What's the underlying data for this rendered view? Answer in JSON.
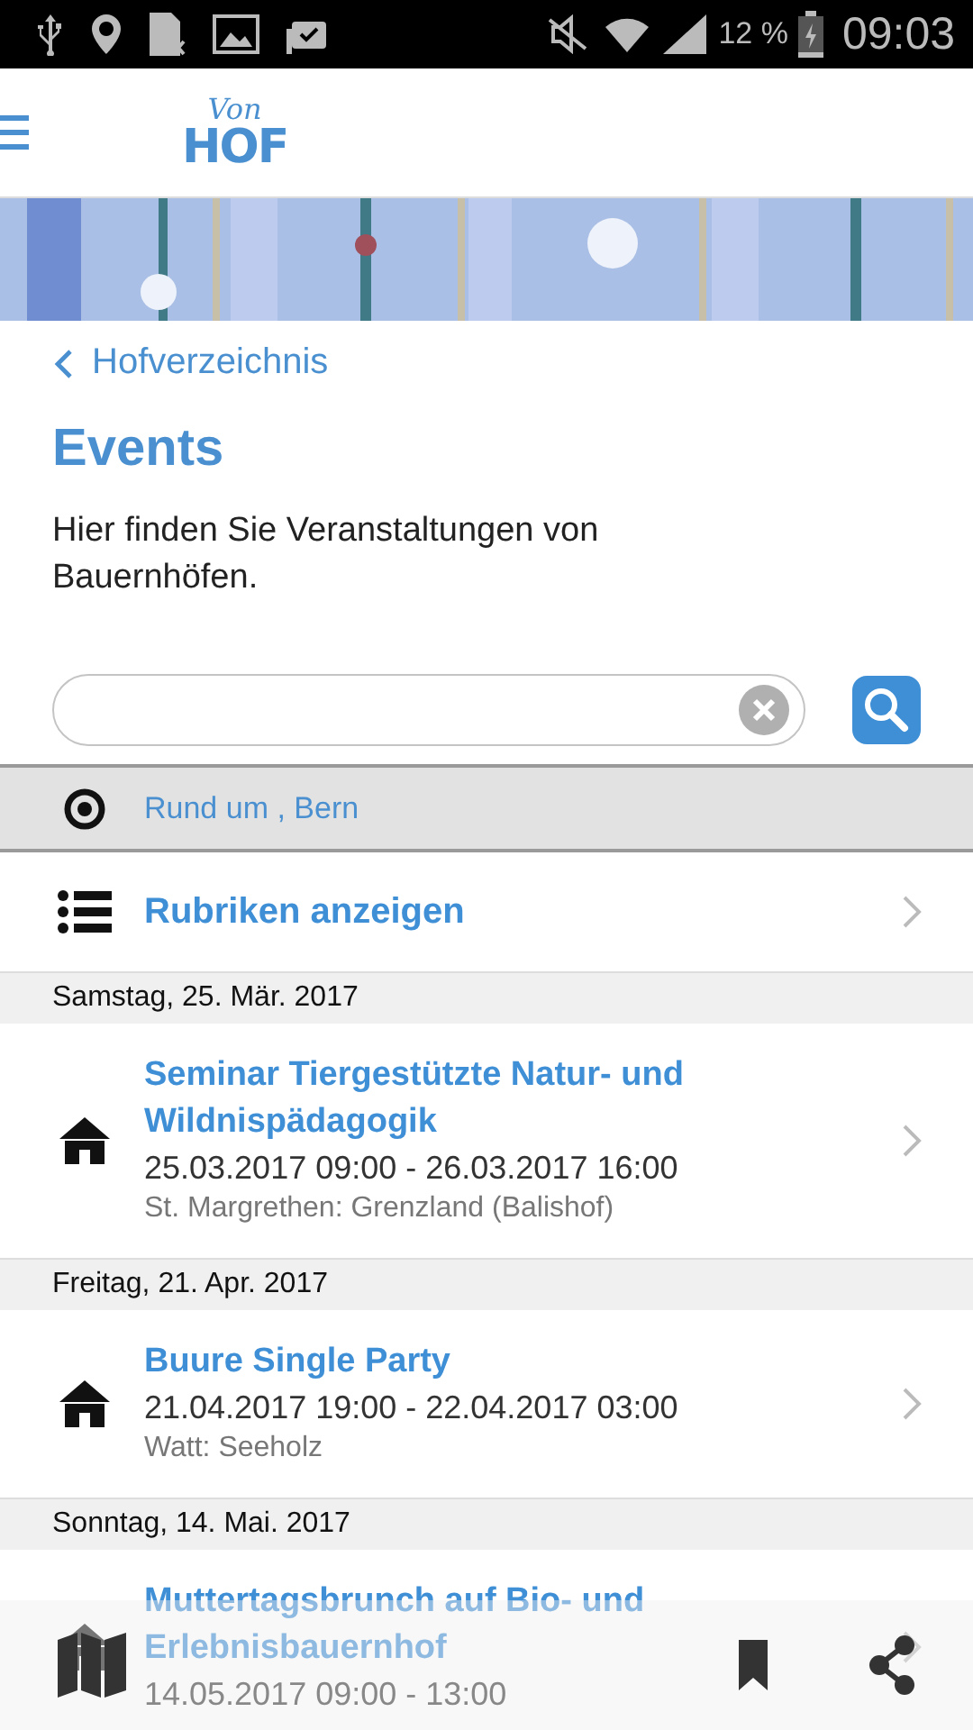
{
  "status_bar": {
    "battery": "12 %",
    "time": "09:03"
  },
  "header": {
    "logo_top": "Von",
    "logo_main": "HOF"
  },
  "back_link": "Hofverzeichnis",
  "title": "Events",
  "description": "Hier finden Sie Veranstaltungen von Bauernhöfen.",
  "location": "Rund um , Bern",
  "categories_link": "Rubriken anzeigen",
  "days": [
    {
      "date": "Samstag, 25. Mär. 2017",
      "events": [
        {
          "title": "Seminar Tiergestützte Natur- und Wildnispädagogik",
          "time": "25.03.2017 09:00 - 26.03.2017 16:00",
          "place": "St. Margrethen: Grenzland (Balishof)"
        }
      ]
    },
    {
      "date": "Freitag, 21. Apr. 2017",
      "events": [
        {
          "title": "Buure Single Party",
          "time": "21.04.2017 19:00 - 22.04.2017 03:00",
          "place": "Watt: Seeholz"
        }
      ]
    },
    {
      "date": "Sonntag, 14. Mai. 2017",
      "events": [
        {
          "title": "Muttertagsbrunch auf Bio- und Erlebnisbauernhof",
          "time": "14.05.2017 09:00 - 13:00"
        }
      ]
    }
  ]
}
